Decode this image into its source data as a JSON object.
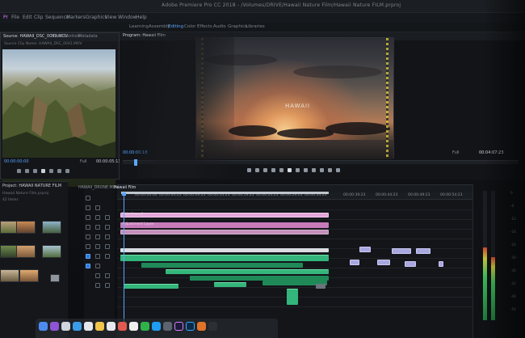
{
  "window": {
    "title": "Adobe Premiere Pro CC 2018 - /Volumes/DRIVE/Hawaii Nature Film/Hawaii Nature FILM.prproj"
  },
  "menu": [
    "Pr",
    "File",
    "Edit",
    "Clip",
    "Sequence",
    "Markers",
    "Graphics",
    "View",
    "Window",
    "Help"
  ],
  "workspaces": [
    {
      "label": "Learning",
      "active": false
    },
    {
      "label": "Assembly",
      "active": false
    },
    {
      "label": "Editing",
      "active": true
    },
    {
      "label": "Color",
      "active": false
    },
    {
      "label": "Effects",
      "active": false
    },
    {
      "label": "Audio",
      "active": false
    },
    {
      "label": "Graphics",
      "active": false
    },
    {
      "label": "Libraries",
      "active": false
    }
  ],
  "source_panel": {
    "tabs": [
      {
        "label": "Source: HAWAII_DSC_0042.MOV",
        "active": true
      },
      {
        "label": "Effect Controls",
        "active": false
      },
      {
        "label": "Metadata",
        "active": false
      },
      {
        "label": "Audio Clip Mixer",
        "active": false
      }
    ],
    "subtitle": "Source Clip Name: HAWAII_DSC_0042.MOV",
    "timecode_in": "00:00:00:00",
    "fit_label": "Full",
    "timecode_out": "00:00:05:13"
  },
  "program_panel": {
    "tab_label": "Program: Hawaii Film",
    "watermark": "HAWAII",
    "timecode_current": "00:00:00:18",
    "fit_label": "Full",
    "timecode_duration": "00:04:07:23"
  },
  "project_panel": {
    "tab_label": "Project: HAWAII NATURE FILM",
    "subtitle": "Hawaii Nature Film.prproj",
    "item_count": "42 Items"
  },
  "timeline": {
    "tabs": [
      {
        "label": "HAWAII_DRONE.MOV",
        "active": false
      },
      {
        "label": "Hawaii Film",
        "active": true
      }
    ],
    "timecode": "00:00:00:18",
    "ruler": [
      "00:00:00:00",
      "00:00:04:23",
      "00:00:09:23",
      "00:00:14:23",
      "00:00:19:23",
      "00:00:24:23",
      "00:00:29:23",
      "00:00:34:23",
      "00:00:39:23",
      "00:00:44:23",
      "00:00:49:23",
      "00:00:54:23",
      "00:00:59:22",
      "00:01:04:22"
    ],
    "track_labels": {
      "title": "Title Hawaii",
      "adjustment": "Adjustment Layer"
    }
  },
  "meters": {
    "db_labels": [
      "0",
      "-6",
      "-12",
      "-18",
      "-24",
      "-30",
      "-36",
      "-42",
      "-48",
      "-54"
    ],
    "levels": [
      0.56,
      0.49
    ]
  },
  "colors": {
    "accent": "#5aa7ff",
    "title_clip": "#e3a6d8",
    "video_clip": "#34b57b",
    "audio_clip": "#a8a8de"
  }
}
